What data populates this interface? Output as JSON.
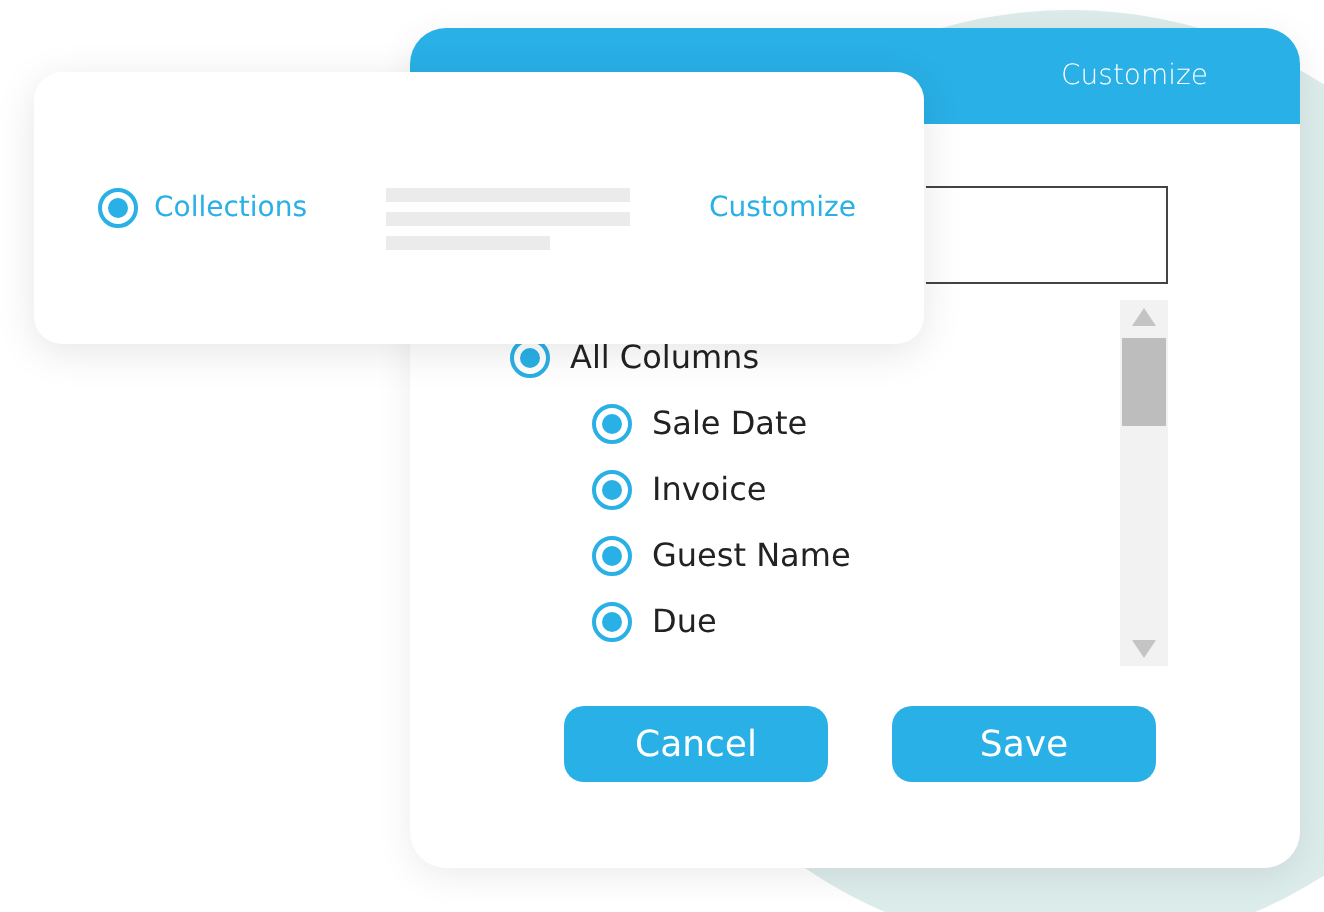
{
  "dialog": {
    "header_title": "Customize",
    "columns": [
      {
        "label": "All Columns",
        "selected": true,
        "children": [
          {
            "label": "Sale Date",
            "selected": true
          },
          {
            "label": "Invoice",
            "selected": true
          },
          {
            "label": "Guest Name",
            "selected": true
          },
          {
            "label": "Due",
            "selected": true
          }
        ]
      }
    ],
    "buttons": [
      "Cancel",
      "Save"
    ]
  },
  "card": {
    "option": {
      "label": "Collections",
      "selected": true
    },
    "link": "Customize"
  }
}
